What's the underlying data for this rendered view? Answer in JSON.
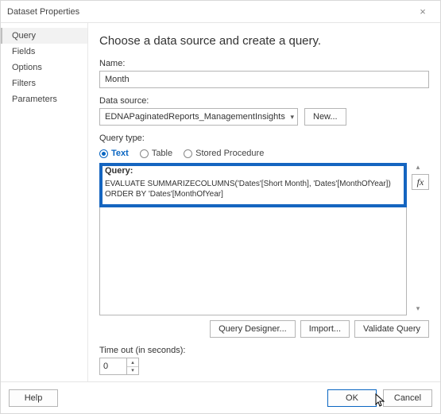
{
  "window": {
    "title": "Dataset Properties",
    "close_glyph": "×"
  },
  "sidebar": {
    "items": [
      {
        "label": "Query"
      },
      {
        "label": "Fields"
      },
      {
        "label": "Options"
      },
      {
        "label": "Filters"
      },
      {
        "label": "Parameters"
      }
    ]
  },
  "main": {
    "heading": "Choose a data source and create a query.",
    "name_label": "Name:",
    "name_value": "Month",
    "ds_label": "Data source:",
    "ds_value": "EDNAPaginatedReports_ManagementInsights",
    "new_btn": "New...",
    "qt_label": "Query type:",
    "qt_options": {
      "text": "Text",
      "table": "Table",
      "sp": "Stored Procedure"
    },
    "query_label": "Query:",
    "query_text": "EVALUATE SUMMARIZECOLUMNS('Dates'[Short Month], 'Dates'[MonthOfYear]) ORDER BY 'Dates'[MonthOfYear]",
    "fx_label": "fx",
    "qd_btn": "Query Designer...",
    "import_btn": "Import...",
    "validate_btn": "Validate Query",
    "timeout_label": "Time out (in seconds):",
    "timeout_value": "0"
  },
  "footer": {
    "help": "Help",
    "ok": "OK",
    "cancel": "Cancel"
  }
}
